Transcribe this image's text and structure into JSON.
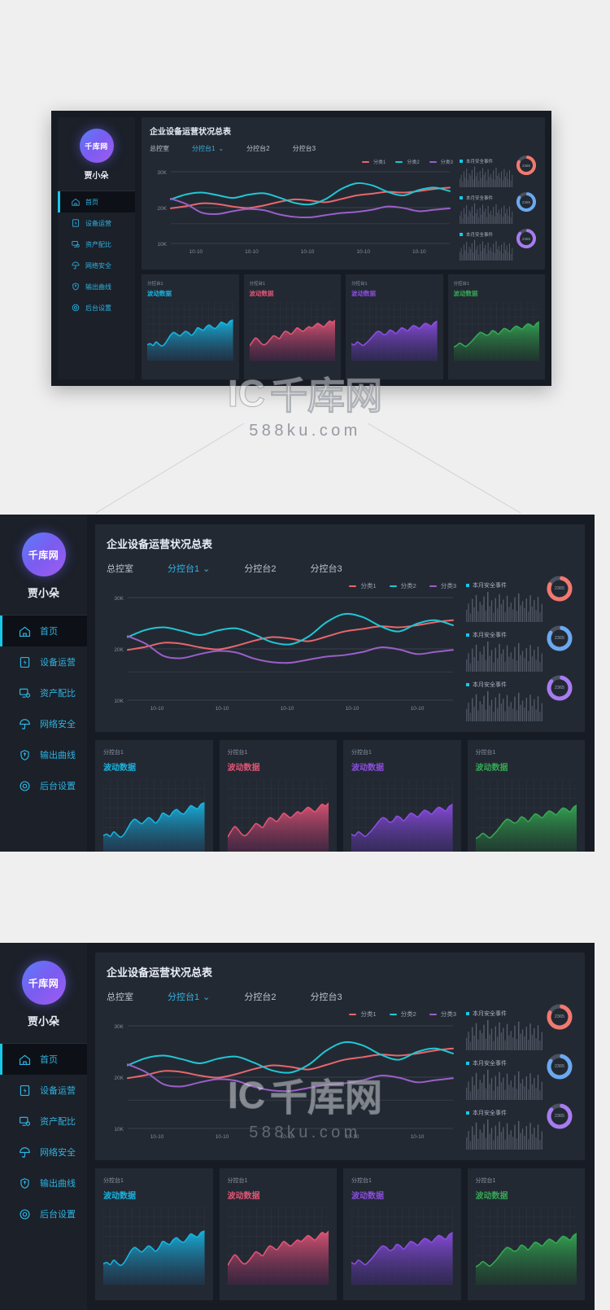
{
  "app": {
    "brand_logo_text": "千库网",
    "user_name": "贾小朵"
  },
  "sidebar": {
    "items": [
      {
        "label": "首页",
        "icon": "home-icon",
        "active": true
      },
      {
        "label": "设备运营",
        "icon": "device-icon",
        "active": false
      },
      {
        "label": "资产配比",
        "icon": "monitor-icon",
        "active": false
      },
      {
        "label": "网络安全",
        "icon": "umbrella-icon",
        "active": false
      },
      {
        "label": "输出曲线",
        "icon": "shield-icon",
        "active": false
      },
      {
        "label": "后台设置",
        "icon": "gear-icon",
        "active": false
      }
    ]
  },
  "main": {
    "title": "企业设备运营状况总表",
    "tabs": [
      {
        "label": "总控室",
        "selected": false,
        "caret": false
      },
      {
        "label": "分控台1",
        "selected": true,
        "caret": true
      },
      {
        "label": "分控台2",
        "selected": false,
        "caret": false
      },
      {
        "label": "分控台3",
        "selected": false,
        "caret": false
      }
    ],
    "caret_glyph": "⌄"
  },
  "right_panel": {
    "cells": [
      {
        "label": "本月安全事件",
        "value": "2365",
        "color": "#f2796f",
        "percent": 78
      },
      {
        "label": "本月安全事件",
        "value": "2365",
        "color": "#6aa9f0",
        "percent": 80
      },
      {
        "label": "本月安全事件",
        "value": "2365",
        "color": "#a77cf0",
        "percent": 82
      }
    ],
    "marker_color": "#17c8e8",
    "track_color": "#4a515e"
  },
  "cards": [
    {
      "tag": "分控台1",
      "title": "波动数据",
      "color": "#17b4e0",
      "fill_top": "#17b4e0",
      "fill_bottom": "#1f3a55"
    },
    {
      "tag": "分控台1",
      "title": "波动数据",
      "color": "#e05575",
      "fill_top": "#e05575",
      "fill_bottom": "#4a2247"
    },
    {
      "tag": "分控台1",
      "title": "波动数据",
      "color": "#8b4de0",
      "fill_top": "#8b4de0",
      "fill_bottom": "#3a2a6a"
    },
    {
      "tag": "分控台1",
      "title": "波动数据",
      "color": "#34a853",
      "fill_top": "#34a853",
      "fill_bottom": "#1e3f2c"
    }
  ],
  "watermark": {
    "mark": "IC",
    "text": "千库网",
    "url": "588ku.com"
  },
  "chart_data": {
    "type": "line",
    "title": "企业设备运营状况总表",
    "xlabel": "",
    "ylabel": "",
    "ylim": [
      10000,
      30000
    ],
    "ytick_labels": [
      "30K",
      "20K",
      "10K"
    ],
    "ytick_values": [
      30000,
      20000,
      10000
    ],
    "x": [
      "10-10",
      "10-10",
      "10-10",
      "10-10",
      "10-10"
    ],
    "xtick_labels": [
      "10-10",
      "10-10",
      "10-10",
      "10-10",
      "10-10"
    ],
    "grid": true,
    "legend_position": "top-right",
    "series": [
      {
        "name": "分类1",
        "color": "#e8676b",
        "values": [
          19800,
          20400,
          21200,
          21000,
          20300,
          19900,
          20600,
          21600,
          22300,
          22000,
          21500,
          22400,
          23400,
          23900,
          24400,
          24200,
          24600,
          25200,
          25600
        ]
      },
      {
        "name": "分类2",
        "color": "#1fc7d4",
        "values": [
          22300,
          23700,
          24200,
          23500,
          22700,
          23600,
          24000,
          22800,
          21300,
          20900,
          22400,
          25200,
          26800,
          26200,
          24400,
          23400,
          24900,
          25600,
          24600
        ]
      },
      {
        "name": "分类3",
        "color": "#9b5fc8",
        "values": [
          22500,
          21000,
          18600,
          18200,
          19000,
          19600,
          19300,
          18100,
          17400,
          17300,
          17900,
          18500,
          18800,
          19400,
          20300,
          19900,
          19000,
          19400,
          19800
        ]
      }
    ],
    "sparkline_bars": {
      "type": "bar",
      "count": 40,
      "values": [
        32,
        48,
        22,
        60,
        38,
        70,
        28,
        52,
        44,
        66,
        30,
        78,
        41,
        56,
        24,
        62,
        35,
        72,
        46,
        58,
        26,
        68,
        39,
        50,
        33,
        64,
        29,
        74,
        43,
        54,
        36,
        61,
        27,
        69,
        40,
        57,
        31,
        65,
        25,
        47
      ]
    },
    "card_areas": [
      {
        "name": "波动数据",
        "values": [
          28,
          30,
          27,
          33,
          29,
          26,
          30,
          38,
          46,
          50,
          47,
          44,
          48,
          52,
          49,
          45,
          50,
          58,
          56,
          54,
          60,
          63,
          59,
          57,
          62,
          68,
          66,
          64,
          70,
          72
        ]
      },
      {
        "name": "波动数据",
        "values": [
          26,
          34,
          40,
          36,
          30,
          28,
          32,
          38,
          44,
          42,
          39,
          46,
          52,
          50,
          47,
          52,
          58,
          55,
          52,
          56,
          60,
          58,
          62,
          66,
          63,
          60,
          65,
          70,
          68,
          72
        ]
      },
      {
        "name": "波动数据",
        "values": [
          30,
          28,
          33,
          30,
          27,
          31,
          36,
          42,
          48,
          52,
          50,
          46,
          48,
          54,
          52,
          48,
          53,
          58,
          56,
          53,
          58,
          62,
          60,
          57,
          62,
          66,
          64,
          61,
          67,
          70
        ]
      },
      {
        "name": "波动数据",
        "values": [
          24,
          27,
          31,
          28,
          25,
          29,
          34,
          40,
          46,
          50,
          48,
          45,
          47,
          53,
          51,
          47,
          52,
          57,
          55,
          52,
          57,
          61,
          59,
          56,
          61,
          65,
          63,
          60,
          66,
          69
        ]
      }
    ]
  }
}
